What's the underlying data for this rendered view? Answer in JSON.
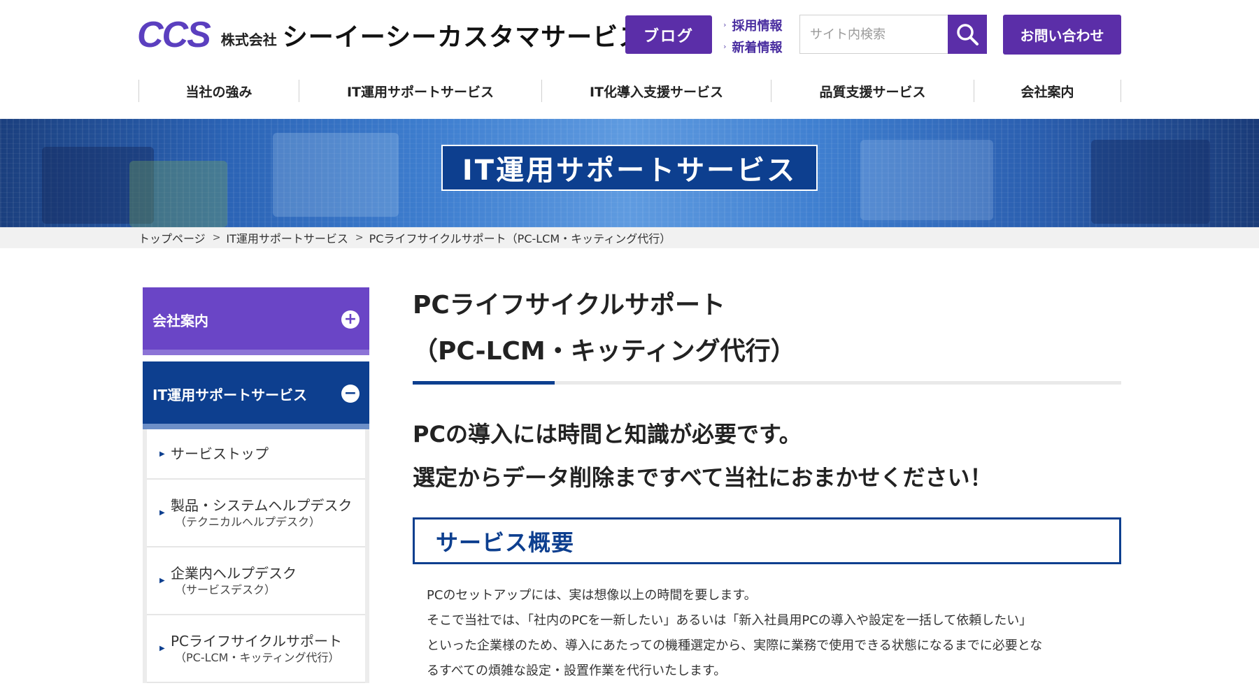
{
  "brand": {
    "logo_mark": "CCS",
    "company_prefix": "株式会社",
    "company_name": "シーイーシーカスタマサービス"
  },
  "header": {
    "blog_label": "ブログ",
    "links": [
      "採用情報",
      "新着情報"
    ],
    "search_placeholder": "サイト内検索",
    "contact_label": "お問い合わせ"
  },
  "nav": [
    "当社の強み",
    "IT運用サポートサービス",
    "IT化導入支援サービス",
    "品質支援サービス",
    "会社案内"
  ],
  "hero": {
    "title": "IT運用サポートサービス"
  },
  "breadcrumb": [
    "トップページ",
    "IT運用サポートサービス",
    "PCライフサイクルサポート（PC-LCM・キッティング代行）"
  ],
  "sidebar": {
    "company": {
      "label": "会社案内",
      "toggle": "+"
    },
    "it": {
      "label": "IT運用サポートサービス",
      "toggle": "−"
    },
    "items": [
      {
        "main": "サービストップ",
        "sub": ""
      },
      {
        "main": "製品・システムヘルプデスク",
        "sub": "（テクニカルヘルプデスク）"
      },
      {
        "main": "企業内ヘルプデスク",
        "sub": "（サービスデスク）"
      },
      {
        "main": "PCライフサイクルサポート",
        "sub": "（PC-LCM・キッティング代行）"
      }
    ]
  },
  "main": {
    "title_line1": "PCライフサイクルサポート",
    "title_line2": "（PC-LCM・キッティング代行）",
    "lead_line1": "PCの導入には時間と知識が必要です。",
    "lead_line2": "選定からデータ削除まですべて当社におまかせください！",
    "section_title": "サービス概要",
    "body_lines": [
      "PCのセットアップには、実は想像以上の時間を要します。",
      "そこで当社では、「社内のPCを一新したい」あるいは「新入社員用PCの導入や設定を一括して依頼したい」",
      "といった企業様のため、導入にあたっての機種選定から、実際に業務で使用できる状態になるまでに必要とな",
      "るすべての煩雑な設定・設置作業を代行いたします。"
    ]
  },
  "colors": {
    "purple": "#5b2ea8",
    "navy": "#0d3f8f",
    "sidebar_purple": "#6a45c6"
  }
}
